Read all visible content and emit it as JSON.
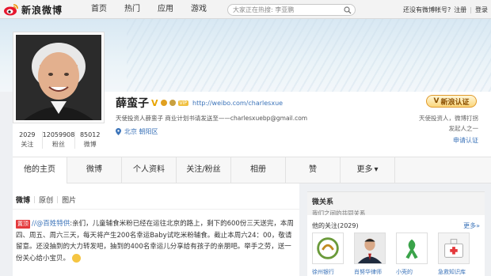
{
  "topbar": {
    "logo_text": "新浪微博",
    "nav": [
      "首页",
      "热门",
      "应用",
      "游戏"
    ],
    "search_placeholder": "大家正在热搜: 李亚鹏",
    "right": {
      "prompt": "还没有微博帐号?",
      "register": "注册",
      "login": "登录"
    }
  },
  "profile": {
    "name": "薛蛮子",
    "v": "V",
    "vip": "VIP",
    "url": "http://weibo.com/charlesxue",
    "description": "天使投资人薛蛮子 商业计划书请发送至——charlesxuebp@gmail.com",
    "location": "北京 朝阳区",
    "counts": [
      {
        "num": "2029",
        "label": "关注"
      },
      {
        "num": "12059908",
        "label": "粉丝"
      },
      {
        "num": "85012",
        "label": "微博"
      }
    ],
    "verify_label": "新浪认证",
    "verify_desc": "天使投资人，微博打拐发起人之一",
    "verify_link": "申请认证"
  },
  "tabs": [
    "他的主页",
    "微博",
    "个人资料",
    "关注/粉丝",
    "相册",
    "赞",
    "更多"
  ],
  "feed": {
    "filters": [
      "微博",
      "原创",
      "图片"
    ],
    "tag": "置顶",
    "mention": "//@百姓特供",
    "text": ":亲们，儿童辅食米粉已经在运往北京的路上，剩下的600份三天送完，本周四、周五、周六三天，每天将产生200名幸运Baby试吃米粉辅食。截止本周六24：00，敬请留意。还没抽到的大力转发吧，抽到的400名幸运儿分享给有孩子的亲朋吧。举手之劳，送一份关心给小宝贝。"
  },
  "sidebar": {
    "title": "微关系",
    "subtitle": "我们之间的共同关系",
    "follow_title": "他的关注(2029)",
    "more": "更多»",
    "friends": [
      "徐州银行",
      "肖努华律师",
      "小壳的",
      "急救知识库"
    ]
  },
  "colors": {
    "link": "#3b73b9",
    "accent": "#e8a400",
    "tag": "#e4393c"
  }
}
